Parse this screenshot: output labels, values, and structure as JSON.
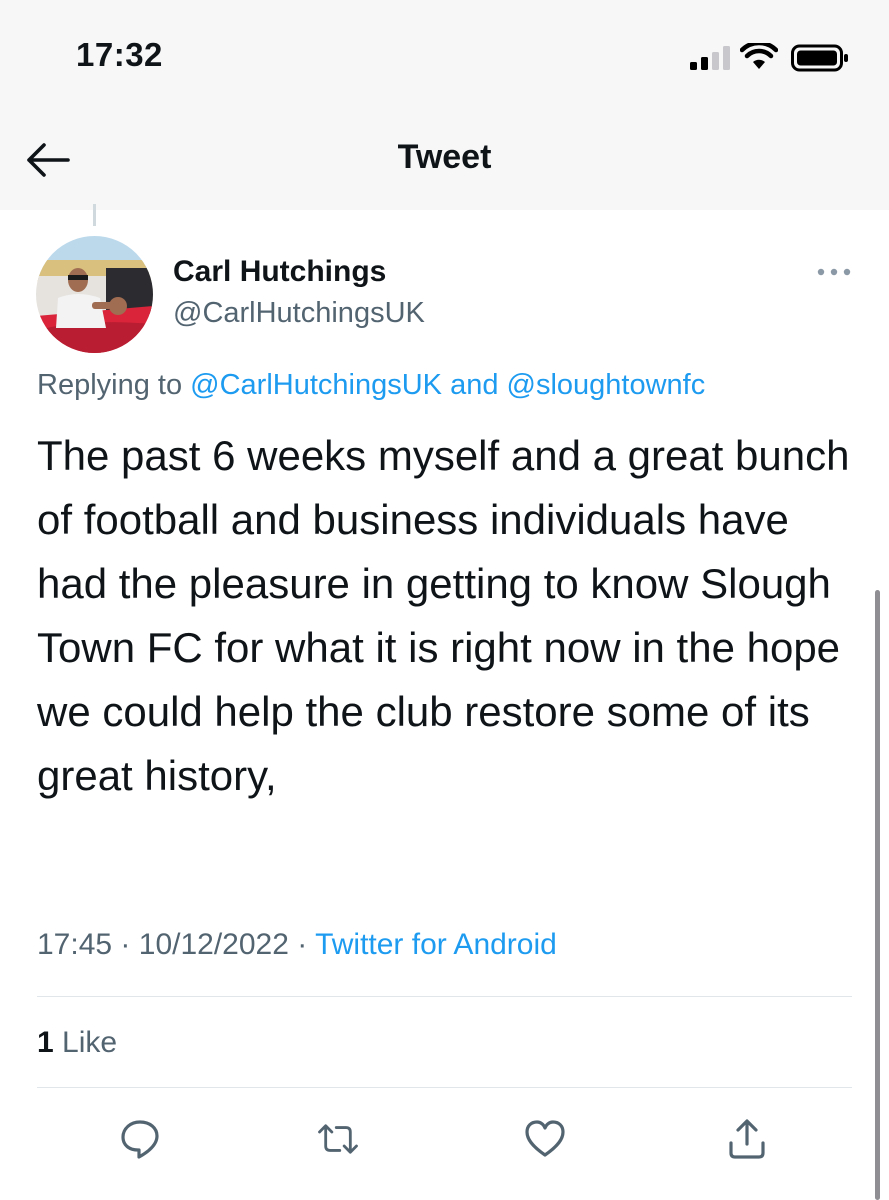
{
  "status_bar": {
    "time": "17:32"
  },
  "nav": {
    "title": "Tweet"
  },
  "tweet": {
    "author_name": "Carl Hutchings",
    "author_handle": "@CarlHutchingsUK",
    "replying_prefix": "Replying to",
    "replying_user_1": "@CarlHutchingsUK",
    "replying_and": "and",
    "replying_user_2": "@sloughtownfc",
    "text": "The past 6 weeks myself and a great bunch of football and business individuals have had the pleasure in getting to know Slough Town FC for what it is right now in the hope we could help the club restore some of its great history,",
    "time": "17:45",
    "date": "10/12/2022",
    "separator": "·",
    "source": "Twitter for Android",
    "likes_count": "1",
    "likes_label": "Like"
  },
  "icons": {
    "back": "arrow-left-icon",
    "more": "more-horizontal-icon",
    "reply": "reply-icon",
    "retweet": "retweet-icon",
    "like": "heart-icon",
    "share": "share-icon"
  },
  "colors": {
    "link": "#1d9bf0",
    "secondary_text": "#536471",
    "primary_text": "#0f1419"
  }
}
